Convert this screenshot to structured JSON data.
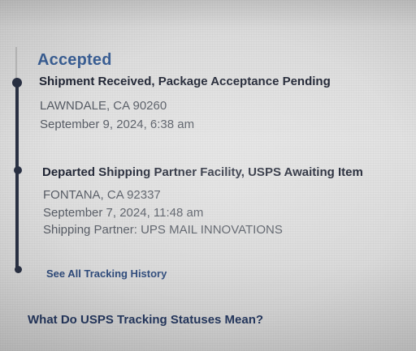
{
  "tracking": {
    "status": "Accepted",
    "events": [
      {
        "title": "Shipment Received, Package Acceptance Pending",
        "location": "LAWNDALE, CA 90260",
        "datetime": "September 9, 2024, 6:38 am"
      },
      {
        "title": "Departed Shipping Partner Facility, USPS Awaiting Item",
        "location": "FONTANA, CA 92337",
        "datetime": "September 7, 2024, 11:48 am",
        "partner": "Shipping Partner: UPS MAIL INNOVATIONS"
      }
    ]
  },
  "links": {
    "all_history": "See All Tracking History",
    "statuses_meaning": "What Do USPS Tracking Statuses Mean?"
  },
  "colors": {
    "status_blue": "#3a5f95",
    "timeline_navy": "#2a3144",
    "link_navy": "#2e4a7a"
  }
}
